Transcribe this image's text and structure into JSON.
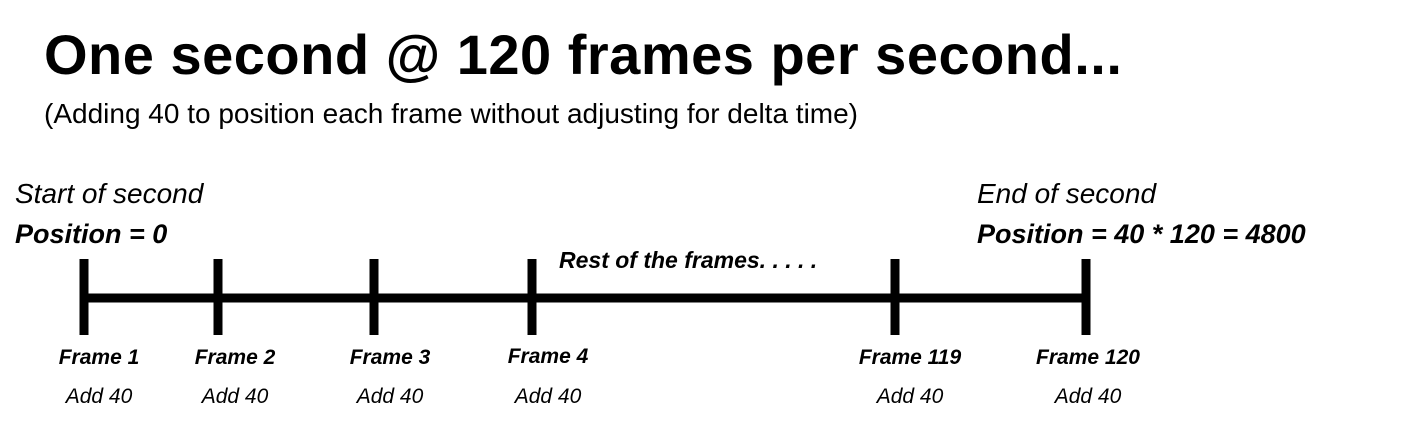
{
  "title": "One second @ 120 frames per second...",
  "subtitle": "(Adding 40 to position each frame without adjusting for delta time)",
  "start": {
    "label": "Start of second",
    "position": "Position = 0"
  },
  "end": {
    "label": "End of second",
    "position": "Position = 40 * 120 = 4800"
  },
  "middle_label": "Rest of the frames. . . . .",
  "frames": [
    {
      "name": "Frame 1",
      "action": "Add 40"
    },
    {
      "name": "Frame 2",
      "action": "Add 40"
    },
    {
      "name": "Frame 3",
      "action": "Add 40"
    },
    {
      "name": "Frame 4",
      "action": "Add 40"
    },
    {
      "name": "Frame 119",
      "action": "Add 40"
    },
    {
      "name": "Frame 120",
      "action": "Add 40"
    }
  ]
}
